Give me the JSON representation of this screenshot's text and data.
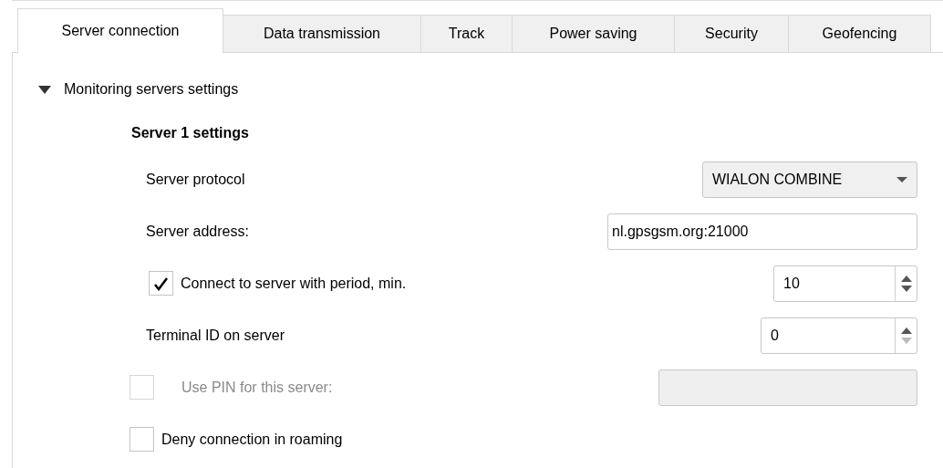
{
  "tabs": [
    {
      "label": "Server connection",
      "selected": true
    },
    {
      "label": "Data transmission",
      "selected": false
    },
    {
      "label": "Track",
      "selected": false
    },
    {
      "label": "Power saving",
      "selected": false
    },
    {
      "label": "Security",
      "selected": false
    },
    {
      "label": "Geofencing",
      "selected": false
    }
  ],
  "section": {
    "title": "Monitoring servers settings",
    "expanded": true
  },
  "group_title": "Server 1 settings",
  "rows": [
    {
      "kind": "select",
      "label": "Server protocol",
      "value": "WIALON COMBINE"
    },
    {
      "kind": "text",
      "label": "Server address:",
      "value": "nl.gpsgsm.org:21000"
    },
    {
      "kind": "check-spin",
      "label": "Connect to server with period, min.",
      "checked": true,
      "value": "10",
      "down_enabled": true
    },
    {
      "kind": "spin",
      "label": "Terminal ID on server",
      "value": "0",
      "down_enabled": false
    },
    {
      "kind": "check-field",
      "label": "Use PIN for this server:",
      "checked": false,
      "disabled": true
    },
    {
      "kind": "check",
      "label": "Deny connection in roaming",
      "checked": false
    }
  ]
}
